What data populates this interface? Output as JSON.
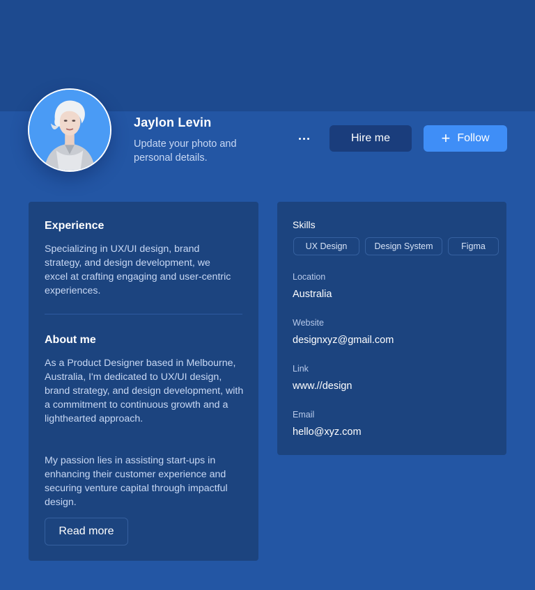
{
  "profile": {
    "name": "Jaylon Levin",
    "subtitle": "Update your photo and personal details."
  },
  "actions": {
    "hire_label": "Hire me",
    "follow_label": "Follow"
  },
  "experience": {
    "title": "Experience",
    "text": "Specializing in UX/UI design, brand strategy, and design development, we excel at crafting engaging and user-centric experiences."
  },
  "about": {
    "title": "About me",
    "paragraph1": "As a Product Designer based in Melbourne, Australia, I'm dedicated to UX/UI design, brand strategy, and design development, with a commitment to continuous growth and a lighthearted approach.",
    "paragraph2": "My passion lies in assisting start-ups in enhancing their customer experience and securing venture capital through impactful design.",
    "read_more_label": "Read more"
  },
  "details": {
    "skills_label": "Skills",
    "skills": [
      "UX Design",
      "Design System",
      "Figma"
    ],
    "location_label": "Location",
    "location": "Australia",
    "website_label": "Website",
    "website": "designxyz@gmail.com",
    "link_label": "Link",
    "link": "www.//design",
    "email_label": "Email",
    "email": "hello@xyz.com"
  },
  "colors": {
    "background": "#2356a4",
    "banner": "#1d4a8f",
    "card": "#1c447f",
    "hire_button": "#1a3d7c",
    "follow_button": "#3f8ef7"
  },
  "icons": {
    "more": "more-horizontal-icon",
    "follow": "plus-icon"
  }
}
